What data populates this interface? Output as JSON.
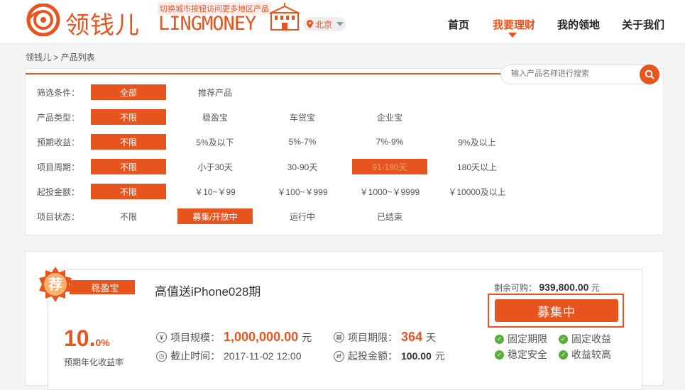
{
  "header": {
    "logo_cn": "领钱儿",
    "logo_en": "LINGMONEY",
    "hint": "切换城市按钮访问更多地区产品",
    "city": "北京",
    "nav": [
      "首页",
      "我要理财",
      "我的领地",
      "关于我们"
    ],
    "active_nav": "我要理财"
  },
  "breadcrumb": "领钱儿 > 产品列表",
  "search": {
    "placeholder": "输入产品名称进行搜索"
  },
  "filters": [
    {
      "label": "筛选条件：",
      "options": [
        "全部",
        "推荐产品"
      ]
    },
    {
      "label": "产品类型：",
      "options": [
        "不限",
        "稳盈宝",
        "车贷宝",
        "企业宝"
      ]
    },
    {
      "label": "预期收益：",
      "options": [
        "不限",
        "5%及以下",
        "5%-7%",
        "7%-9%",
        "9%及以上"
      ]
    },
    {
      "label": "项目周期：",
      "options": [
        "不限",
        "小于30天",
        "30-90天",
        "91-180天",
        "180天以上"
      ]
    },
    {
      "label": "起投金额：",
      "options": [
        "不限",
        "￥10~￥99",
        "￥100~￥999",
        "￥1000~￥9999",
        "￥10000及以上"
      ]
    },
    {
      "label": "项目状态：",
      "options": [
        "不限",
        "募集/开放中",
        "运行中",
        "已结束"
      ]
    }
  ],
  "product": {
    "badge": "荐",
    "tag": "稳盈宝",
    "title": "高值送iPhone028期",
    "remain_label": "剩余可购：",
    "remain_value": "939,800.00",
    "remain_unit": "元",
    "buy_label": "募集中",
    "rate_int": "10.",
    "rate_dec": "0",
    "rate_pct": "%",
    "rate_label": "预期年化收益率",
    "scale_label": "项目规模：",
    "scale_value": "1,000,000.00",
    "scale_unit": "元",
    "period_label": "项目期限：",
    "period_value": "364",
    "period_unit": "天",
    "deadline_label": "截止时间：",
    "deadline_value": "2017-11-02 12:00",
    "min_label": "起投金额：",
    "min_value": "100.00",
    "min_unit": "元",
    "features": [
      "固定期限",
      "固定收益",
      "稳定安全",
      "收益较高"
    ]
  },
  "colors": {
    "accent": "#e8541e",
    "check": "#5aad37"
  }
}
